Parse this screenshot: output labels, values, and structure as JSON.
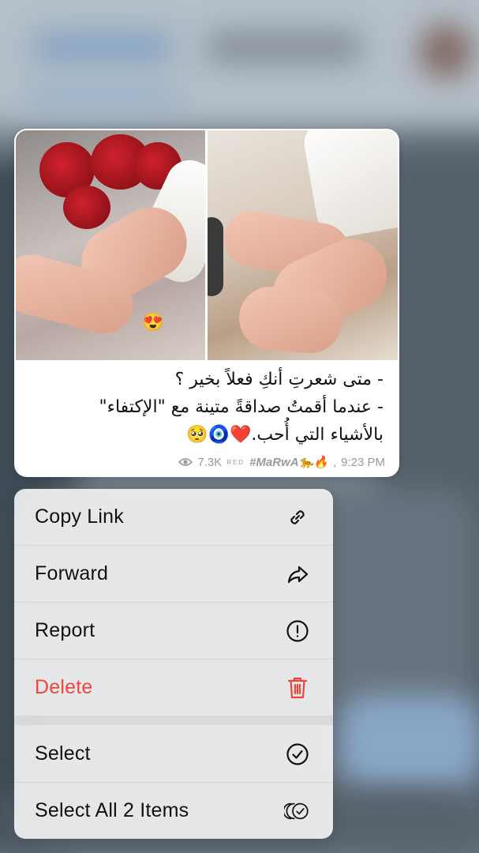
{
  "message": {
    "caption_lines": [
      "- متى شعرتِ أنكِ فعلاً بخير ؟",
      "- عندما أقمتُ صداقةً متينة مع \"الإكتفاء\"",
      "بالأشياء التي أُحب.❤️🧿🥺"
    ],
    "views": "7.3K",
    "signature_prefix": "RED",
    "signature": "#MaRwA🐆🔥",
    "time": "9:23 PM",
    "photo_emoji": "😍"
  },
  "menu": {
    "items": [
      {
        "label": "Copy Link",
        "icon": "link-icon"
      },
      {
        "label": "Forward",
        "icon": "forward-arrow-icon"
      },
      {
        "label": "Report",
        "icon": "exclamation-circle-icon"
      },
      {
        "label": "Delete",
        "icon": "trash-icon",
        "color": "#f0453a"
      },
      {
        "label": "Select",
        "icon": "check-circle-icon"
      },
      {
        "label": "Select All 2 Items",
        "icon": "multi-check-circle-icon"
      }
    ]
  },
  "colors": {
    "danger": "#f0453a",
    "menu_background": "#f0f0f0",
    "meta_text": "#9a9a9a"
  }
}
